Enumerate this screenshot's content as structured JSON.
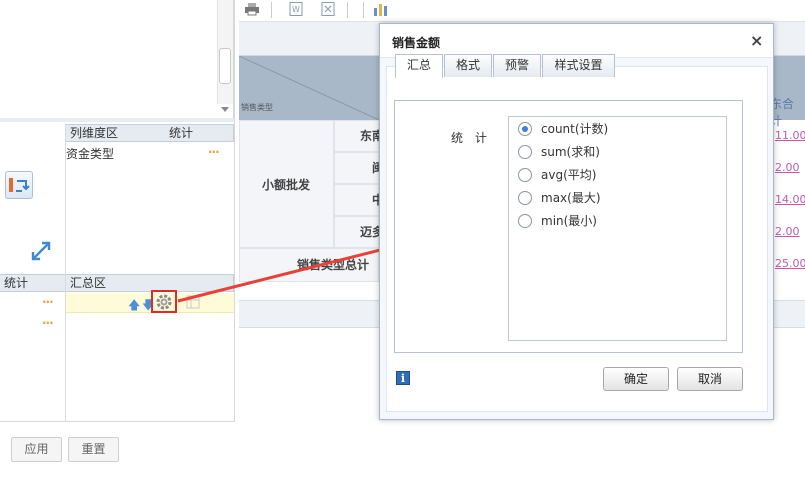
{
  "designer": {
    "col_zone_label": "列维度区",
    "col_zone_stat": "统计",
    "col_field": "资金类型",
    "dots": "···",
    "sum_zone_label": "汇总区",
    "stat_zone_label": "统计",
    "apply_button": "应用",
    "reset_button": "重置"
  },
  "report": {
    "corner_label": "销售类型",
    "col_header_partial": "东合计",
    "row_group": "小额批发",
    "row_items": [
      "东南",
      "闽",
      "中",
      "迈多"
    ],
    "total_label": "销售类型总计",
    "values": [
      "11.00",
      "2.00",
      "14.00",
      "2.00",
      "25.00"
    ]
  },
  "dialog": {
    "title": "销售金额",
    "close": "×",
    "tabs": [
      "汇总",
      "格式",
      "预警",
      "样式设置"
    ],
    "active_tab": 0,
    "stat_label": "统 计",
    "options": [
      "count(计数)",
      "sum(求和)",
      "avg(平均)",
      "max(最大)",
      "min(最小)"
    ],
    "selected_option": 0,
    "info": "i",
    "ok": "确定",
    "cancel": "取消"
  },
  "colors": {
    "accent": "#3b7fd9",
    "highlight_box": "#e02a2a",
    "arrow": "#e8413a",
    "value_link": "#c25aaa"
  }
}
